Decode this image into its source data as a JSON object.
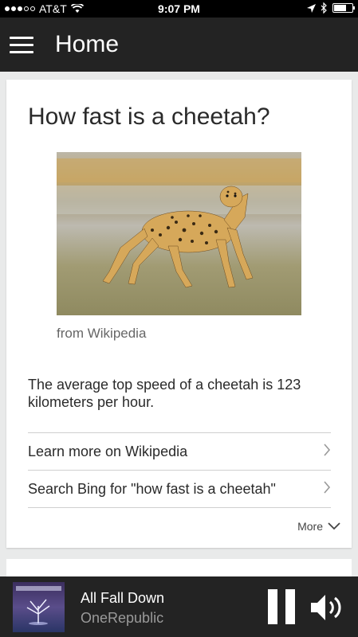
{
  "status_bar": {
    "carrier": "AT&T",
    "time": "9:07 PM"
  },
  "header": {
    "title": "Home"
  },
  "card": {
    "question": "How fast is a cheetah?",
    "image_source": "from Wikipedia",
    "answer": "The average top speed of a cheetah is 123 kilometers per hour.",
    "links": [
      {
        "label": "Learn more on Wikipedia"
      },
      {
        "label": "Search Bing for \"how fast is a cheetah\""
      }
    ],
    "more_label": "More"
  },
  "player": {
    "title": "All Fall Down",
    "artist": "OneRepublic"
  },
  "colors": {
    "header_bg": "#232323",
    "page_bg": "#e9eaea",
    "card_bg": "#ffffff"
  }
}
